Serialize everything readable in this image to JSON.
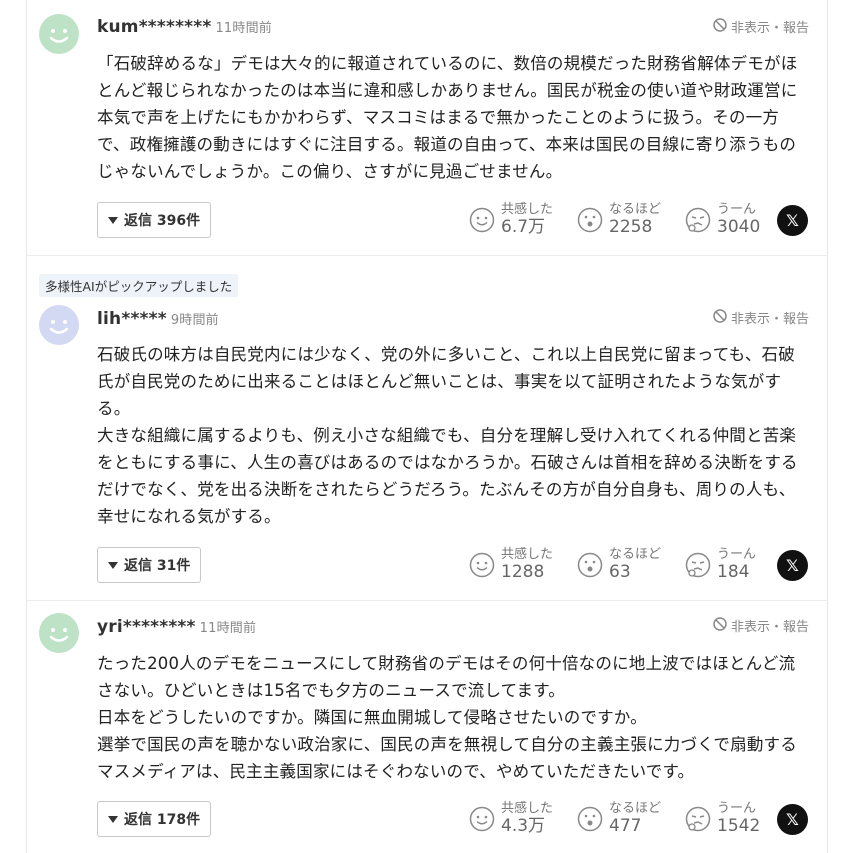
{
  "hide_report_label": "非表示・報告",
  "reaction_labels": {
    "empathy": "共感した",
    "naruhodo": "なるほど",
    "uun": "うーん"
  },
  "pick_badge": "多様性AIがピックアップしました",
  "x_label": "𝕏",
  "comments": [
    {
      "user": "kum********",
      "time": "11時間前",
      "avatar_color": "#bde2c6",
      "text": "「石破辞めるな」デモは大々的に報道されているのに、数倍の規模だった財務省解体デモがほとんど報じられなかったのは本当に違和感しかありません。国民が税金の使い道や財政運営に本気で声を上げたにもかかわらず、マスコミはまるで無かったことのように扱う。その一方で、政権擁護の動きにはすぐに注目する。報道の自由って、本来は国民の目線に寄り添うものじゃないんでしょうか。この偏り、さすがに見過ごせません。",
      "reply": "返信 396件",
      "empathy": "6.7万",
      "naruhodo": "2258",
      "uun": "3040"
    },
    {
      "user": "lih*****",
      "time": "9時間前",
      "avatar_color": "#d3d8f3",
      "text": "石破氏の味方は自民党内には少なく、党の外に多いこと、これ以上自民党に留まっても、石破氏が自民党のために出来ることはほとんど無いことは、事実を以て証明されたような気がする。\n大きな組織に属するよりも、例え小さな組織でも、自分を理解し受け入れてくれる仲間と苦楽をともにする事に、人生の喜びはあるのではなかろうか。石破さんは首相を辞める決断をするだけでなく、党を出る決断をされたらどうだろう。たぶんその方が自分自身も、周りの人も、幸せになれる気がする。",
      "reply": "返信 31件",
      "empathy": "1288",
      "naruhodo": "63",
      "uun": "184"
    },
    {
      "user": "yri********",
      "time": "11時間前",
      "avatar_color": "#bde2c6",
      "text": "たった200人のデモをニュースにして財務省のデモはその何十倍なのに地上波ではほとんど流さない。ひどいときは15名でも夕方のニュースで流してます。\n日本をどうしたいのですか。隣国に無血開城して侵略させたいのですか。\n選挙で国民の声を聴かない政治家に、国民の声を無視して自分の主義主張に力づくで扇動するマスメディアは、民主主義国家にはそぐわないので、やめていただきたいです。",
      "reply": "返信 178件",
      "empathy": "4.3万",
      "naruhodo": "477",
      "uun": "1542"
    }
  ]
}
